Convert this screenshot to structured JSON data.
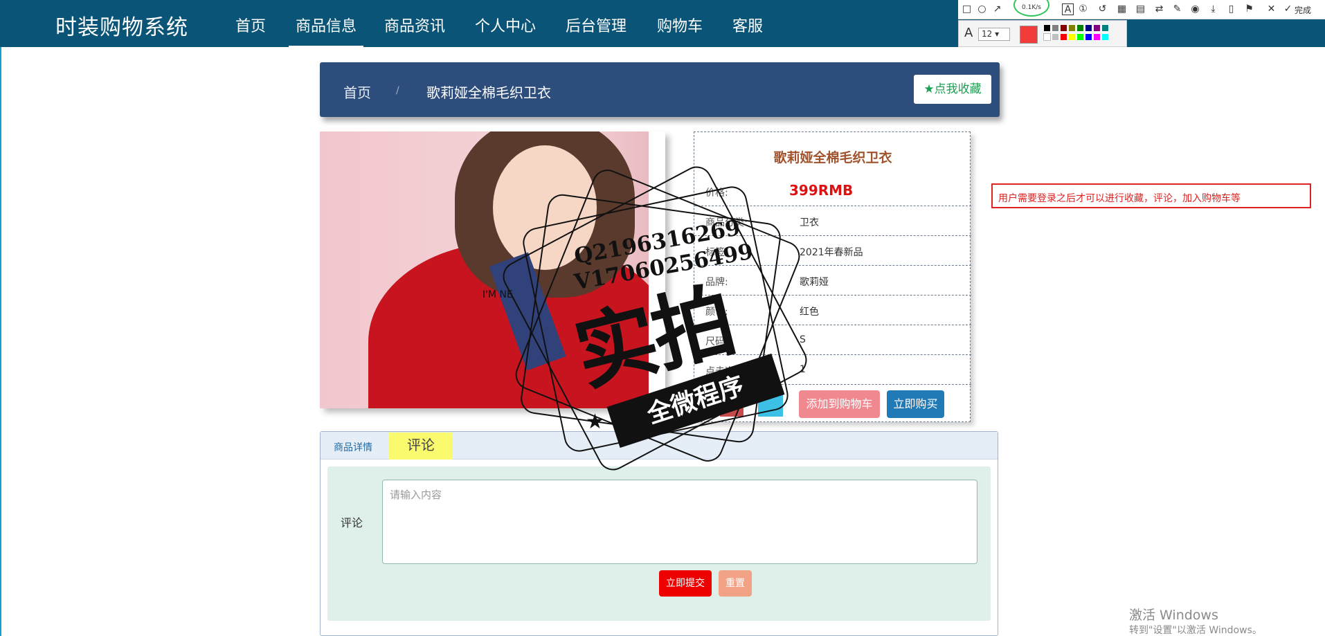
{
  "app": {
    "title": "时装购物系统"
  },
  "nav": {
    "items": [
      {
        "label": "首页"
      },
      {
        "label": "商品信息"
      },
      {
        "label": "商品资讯"
      },
      {
        "label": "个人中心"
      },
      {
        "label": "后台管理"
      },
      {
        "label": "购物车"
      },
      {
        "label": "客服"
      }
    ],
    "active": "商品信息"
  },
  "breadcrumb": {
    "home": "首页",
    "separator": "/",
    "current": "歌莉娅全棉毛织卫衣"
  },
  "favorite_button": {
    "label": "点我收藏",
    "icon": "star-icon"
  },
  "product": {
    "image_text": "I'M NE",
    "title": "歌莉娅全棉毛织卫衣",
    "price_label": "价格:",
    "price": "399RMB",
    "rows": [
      {
        "label": "商品分类:",
        "value": "卫衣"
      },
      {
        "label": "标签:",
        "value": "2021年春新品"
      },
      {
        "label": "品牌:",
        "value": "歌莉娅"
      },
      {
        "label": "颜色:",
        "value": "红色"
      },
      {
        "label": "尺码:",
        "value": "S"
      },
      {
        "label": "点击次数:",
        "value": "1"
      }
    ],
    "add_to_cart": "添加到购物车",
    "buy_now": "立即购买"
  },
  "tabs": {
    "items": [
      {
        "label": "商品详情"
      },
      {
        "label": "评论"
      }
    ],
    "active": "评论"
  },
  "comment_form": {
    "label": "评论",
    "placeholder": "请输入内容",
    "submit": "立即提交",
    "reset": "重置"
  },
  "annotation": {
    "text": "用户需要登录之后才可以进行收藏，评论，加入购物车等"
  },
  "screenshot_tool": {
    "font_size": "12",
    "done_label": "完成",
    "net_speed": "0.1K/s",
    "current_color": "#f23c3c",
    "palette": [
      "#000000",
      "#808080",
      "#800000",
      "#808000",
      "#008000",
      "#000080",
      "#800080",
      "#008080",
      "#ffffff",
      "#c0c0c0",
      "#ff0000",
      "#ffff00",
      "#00ff00",
      "#0000ff",
      "#ff00ff",
      "#00ffff"
    ]
  },
  "watermark": {
    "line1": "Q2196316269",
    "line2": "V17060256499",
    "big_text": "实拍",
    "ribbon": "全微程序"
  },
  "windows_activation": {
    "title": "激活 Windows",
    "subtitle": "转到\"设置\"以激活 Windows。"
  },
  "colors": {
    "nav_bg": "#0a5577",
    "breadcrumb_bg": "#2d4e7d",
    "price": "#dd1111",
    "title": "#a0522d",
    "cart_button": "#f0898f",
    "buy_button": "#1f7ab6",
    "submit_button": "#ee0000",
    "reset_button": "#f3a385",
    "comment_tab": "#fafa6e",
    "comment_bg": "#dff0ea"
  }
}
